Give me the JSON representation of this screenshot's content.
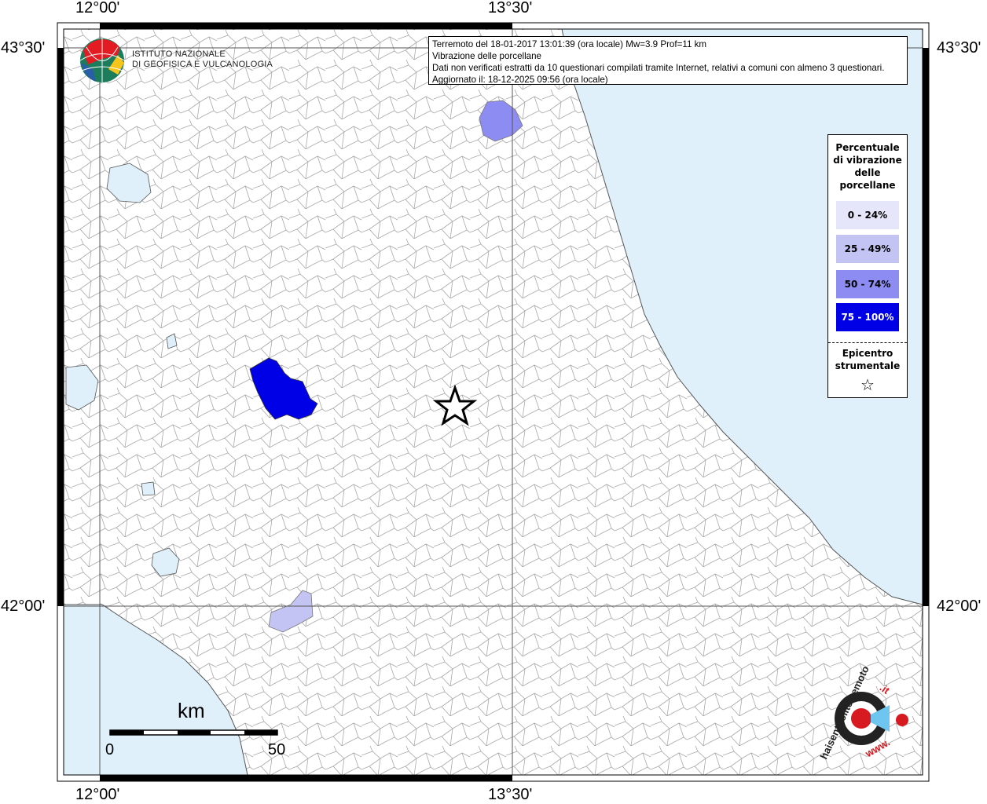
{
  "header": {
    "line1": "Terremoto del 18-01-2017 13:01:39 (ora locale) Mw=3.9 Prof=11 km",
    "line2": "Vibrazione delle porcellane",
    "line3": "Dati non verificati estratti da 10 questionari compilati tramite Internet, relativi a comuni con almeno 3 questionari.",
    "line4": "Aggiornato il: 18-12-2025 09:56 (ora locale)"
  },
  "coords": {
    "top_left": "12°00'",
    "top_right": "13°30'",
    "bottom_left": "12°00'",
    "bottom_right": "13°30'",
    "left_top": "43°30'",
    "left_bottom": "42°00'",
    "right_top": "43°30'",
    "right_bottom": "42°00'"
  },
  "logo": {
    "line1": "ISTITUTO NAZIONALE",
    "line2": "DI GEOFISICA E VULCANOLOGIA"
  },
  "legend": {
    "title_lines": [
      "Percentuale",
      "di vibrazione",
      "delle",
      "porcellane"
    ],
    "classes": [
      {
        "label": "0 - 24%",
        "color": "#e6e6fb"
      },
      {
        "label": "25 - 49%",
        "color": "#c4c4f4"
      },
      {
        "label": "50 - 74%",
        "color": "#8c8cf2"
      },
      {
        "label": "75 - 100%",
        "color": "#0000e6"
      }
    ],
    "epicentre_lines": [
      "Epicentro",
      "strumentale"
    ],
    "star": "☆"
  },
  "scale": {
    "unit": "km",
    "start": "0",
    "end": "50"
  },
  "watermark": {
    "text_main": "haisentitoilterremoto",
    "text_tld": ".it",
    "text_www": "www."
  },
  "colors": {
    "sea": "#dff0fb",
    "land": "#ffffff",
    "boundaries": "#9a9a9a",
    "class_50_74": "#8c8cf2",
    "class_75_100": "#0000e6",
    "class_25_49": "#c4c4f4",
    "brand_red": "#d71920"
  }
}
